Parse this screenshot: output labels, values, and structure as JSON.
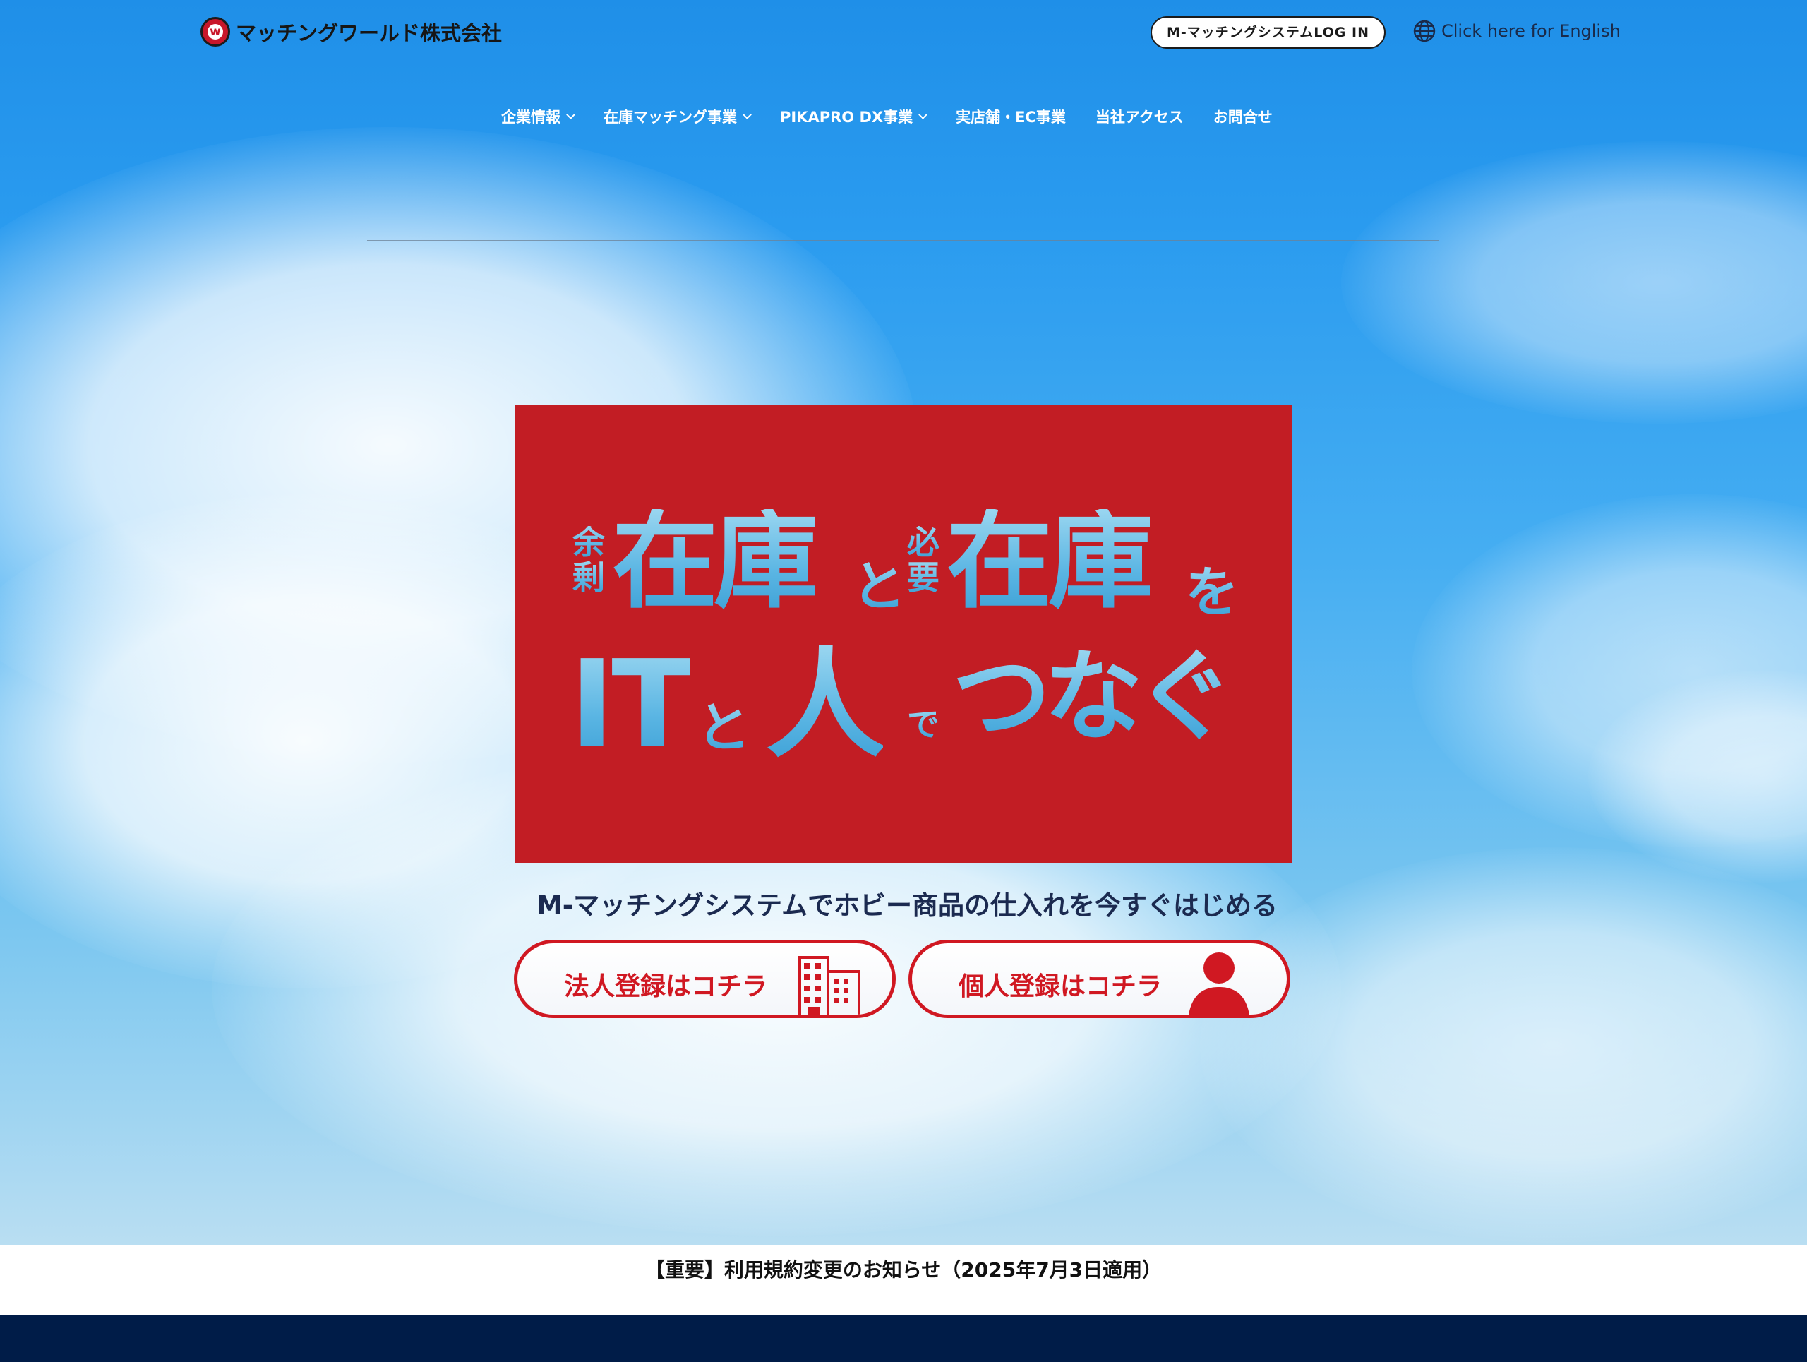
{
  "header": {
    "company_name": "マッチングワールド株式会社",
    "logo_letter": "w",
    "login_label": "M-マッチングシステムLOG IN",
    "english_label": "Click here for English"
  },
  "nav": {
    "items": [
      {
        "label": "企業情報",
        "has_dropdown": true
      },
      {
        "label": "在庫マッチング事業",
        "has_dropdown": true
      },
      {
        "label": "PIKAPRO DX事業",
        "has_dropdown": true
      },
      {
        "label": "実店舗・EC事業",
        "has_dropdown": false
      },
      {
        "label": "当社アクセス",
        "has_dropdown": false
      },
      {
        "label": "お問合せ",
        "has_dropdown": false
      }
    ]
  },
  "banner": {
    "surplus_top": "余",
    "surplus_bottom": "剰",
    "stock_1": "在庫",
    "to_1": "と",
    "needed_top": "必",
    "needed_bottom": "要",
    "stock_2": "在庫",
    "wo": "を",
    "it": "IT",
    "to_2": "と",
    "person": "人",
    "de": "で",
    "connect": "つなぐ",
    "color_bg": "#c21d24",
    "color_text": "#6fc3ea"
  },
  "hero": {
    "subline": "M-マッチングシステムでホビー商品の仕入れを今すぐはじめる",
    "corporate_button": "法人登録はコチラ",
    "personal_button": "個人登録はコチラ",
    "accent_color": "#d01822"
  },
  "notice": {
    "text": "【重要】利用規約変更のお知らせ（2025年7月3日適用）"
  },
  "footer": {
    "color": "#001c48"
  }
}
